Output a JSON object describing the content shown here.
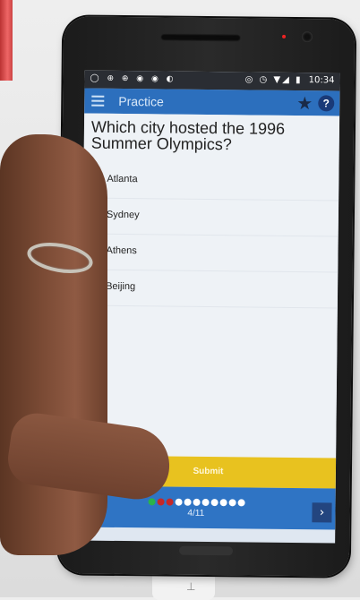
{
  "status_bar": {
    "left_icons": "◯ ⊕ ⊕ ◉ ◉ ◐",
    "right_icons": "◎ ◷ ▼◢ ▮",
    "time": "10:34"
  },
  "app_bar": {
    "title": "Practice",
    "menu_icon": "menu-icon",
    "star_icon": "star-icon",
    "help_icon": "help-icon",
    "star_glyph": "★",
    "help_glyph": "?"
  },
  "question": {
    "text": "Which city hosted the 1996 Summer Olympics?",
    "options": [
      {
        "label": "Atlanta",
        "selected": true
      },
      {
        "label": "Sydney",
        "selected": false
      },
      {
        "label": "Athens",
        "selected": false
      },
      {
        "label": "Beijing",
        "selected": false
      }
    ]
  },
  "submit_label": "Submit",
  "navigation": {
    "prev_glyph": "‹",
    "next_glyph": "›",
    "progress": "4/11",
    "dot_colors": [
      "#2bb34a",
      "#c62828",
      "#c62828",
      "#ffffff",
      "#ffffff",
      "#ffffff",
      "#ffffff",
      "#ffffff",
      "#ffffff",
      "#ffffff",
      "#ffffff"
    ]
  },
  "colors": {
    "app_bar": "#2c6fbd",
    "submit": "#e8c21f",
    "navbar": "#2f74c4"
  }
}
